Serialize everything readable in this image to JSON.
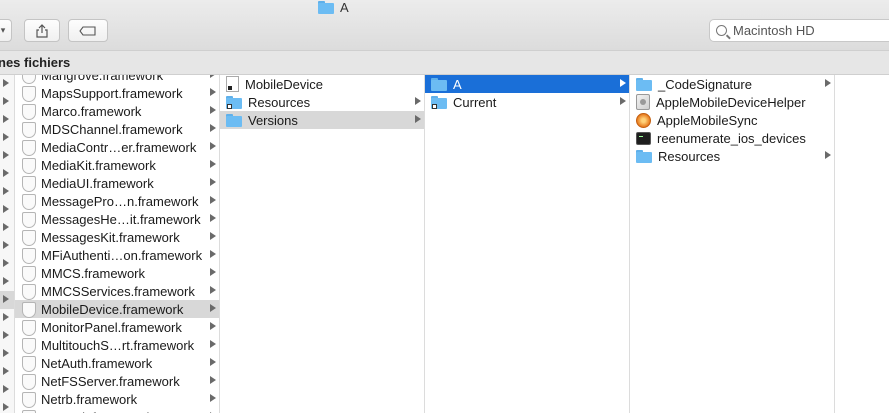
{
  "window": {
    "title": "A"
  },
  "search": {
    "placeholder": "Macintosh HD"
  },
  "pathbar": {
    "label": "nes fichiers"
  },
  "column1": [
    "Mangrove.framework",
    "MapsSupport.framework",
    "Marco.framework",
    "MDSChannel.framework",
    "MediaContr…er.framework",
    "MediaKit.framework",
    "MediaUI.framework",
    "MessagePro…n.framework",
    "MessagesHe…it.framework",
    "MessagesKit.framework",
    "MFiAuthenti…on.framework",
    "MMCS.framework",
    "MMCSServices.framework",
    "MobileDevice.framework",
    "MonitorPanel.framework",
    "MultitouchS…rt.framework",
    "NetAuth.framework",
    "NetFSServer.framework",
    "Netrb.framework",
    "Network.framework"
  ],
  "column2": [
    {
      "label": "MobileDevice",
      "icon": "alias-document-icon"
    },
    {
      "label": "Resources",
      "icon": "alias-folder-icon"
    },
    {
      "label": "Versions",
      "icon": "folder-icon"
    }
  ],
  "column3": [
    {
      "label": "A",
      "icon": "folder-icon"
    },
    {
      "label": "Current",
      "icon": "alias-folder-icon"
    }
  ],
  "column4": [
    {
      "label": "_CodeSignature",
      "icon": "folder-icon"
    },
    {
      "label": "AppleMobileDeviceHelper",
      "icon": "app-icon"
    },
    {
      "label": "AppleMobileSync",
      "icon": "sync-app-icon"
    },
    {
      "label": "reenumerate_ios_devices",
      "icon": "terminal-icon"
    },
    {
      "label": "Resources",
      "icon": "folder-icon"
    }
  ],
  "colors": {
    "selection": "#1a6fd8",
    "inactive_selection": "#d8d8d8",
    "folder": "#6cbcf3"
  }
}
